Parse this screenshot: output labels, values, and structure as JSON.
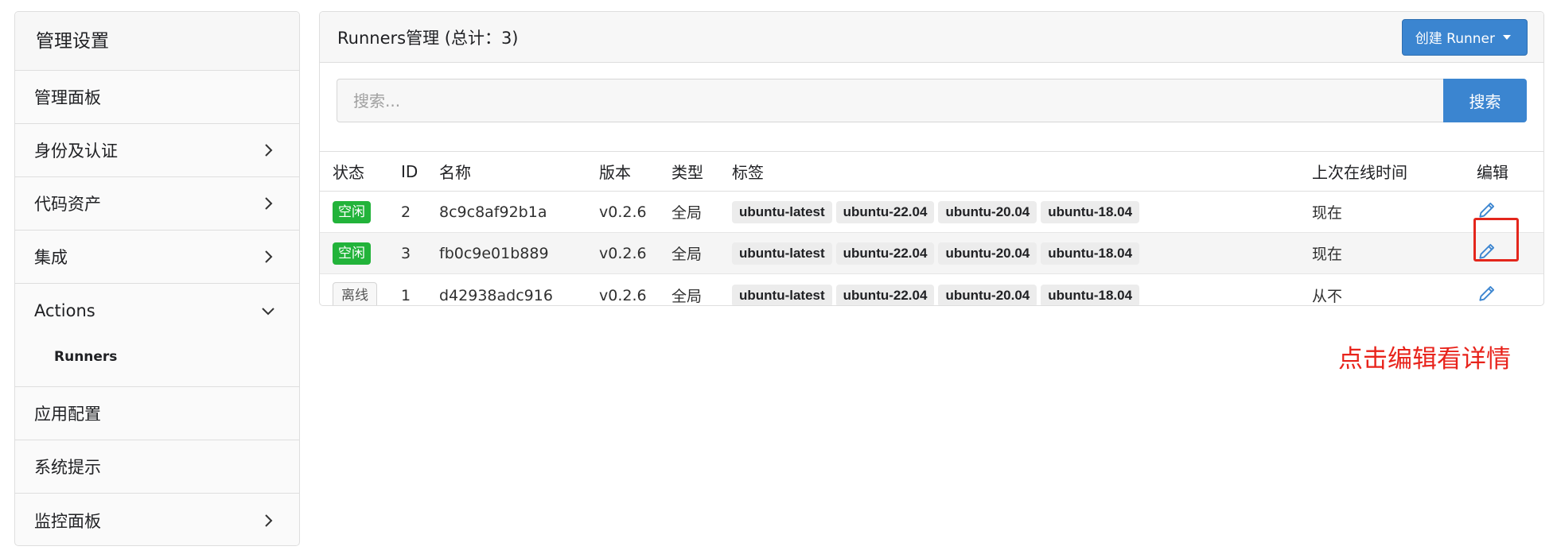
{
  "sidebar": {
    "title": "管理设置",
    "items": [
      {
        "label": "管理面板",
        "chevron": "none"
      },
      {
        "label": "身份及认证",
        "chevron": "right"
      },
      {
        "label": "代码资产",
        "chevron": "right"
      },
      {
        "label": "集成",
        "chevron": "right"
      },
      {
        "label": "Actions",
        "chevron": "down",
        "subitems": [
          {
            "label": "Runners"
          }
        ]
      },
      {
        "label": "应用配置",
        "chevron": "none"
      },
      {
        "label": "系统提示",
        "chevron": "none"
      },
      {
        "label": "监控面板",
        "chevron": "right"
      }
    ]
  },
  "panel": {
    "title": "Runners管理 (总计：3)",
    "create_button": "创建 Runner"
  },
  "search": {
    "placeholder": "搜索...",
    "button": "搜索"
  },
  "table": {
    "headers": {
      "status": "状态",
      "id": "ID",
      "name": "名称",
      "version": "版本",
      "type": "类型",
      "tags": "标签",
      "last_online": "上次在线时间",
      "edit": "编辑"
    },
    "rows": [
      {
        "status": "空闲",
        "status_kind": "idle",
        "id": "2",
        "name": "8c9c8af92b1a",
        "version": "v0.2.6",
        "type": "全局",
        "tags": [
          "ubuntu-latest",
          "ubuntu-22.04",
          "ubuntu-20.04",
          "ubuntu-18.04"
        ],
        "last_online": "现在"
      },
      {
        "status": "空闲",
        "status_kind": "idle",
        "id": "3",
        "name": "fb0c9e01b889",
        "version": "v0.2.6",
        "type": "全局",
        "tags": [
          "ubuntu-latest",
          "ubuntu-22.04",
          "ubuntu-20.04",
          "ubuntu-18.04"
        ],
        "last_online": "现在"
      },
      {
        "status": "离线",
        "status_kind": "offline",
        "id": "1",
        "name": "d42938adc916",
        "version": "v0.2.6",
        "type": "全局",
        "tags": [
          "ubuntu-latest",
          "ubuntu-22.04",
          "ubuntu-20.04",
          "ubuntu-18.04"
        ],
        "last_online": "从不"
      }
    ]
  },
  "annotation": {
    "text": "点击编辑看详情"
  },
  "colors": {
    "accent": "#3b85d0",
    "idle_badge": "#22b33a",
    "annotation_red": "#e3261c",
    "edit_icon": "#3b85d0"
  },
  "icons": {
    "chevron_right": "chevron-right-icon",
    "chevron_down": "chevron-down-icon",
    "edit": "pencil-icon",
    "caret": "caret-down-icon"
  }
}
